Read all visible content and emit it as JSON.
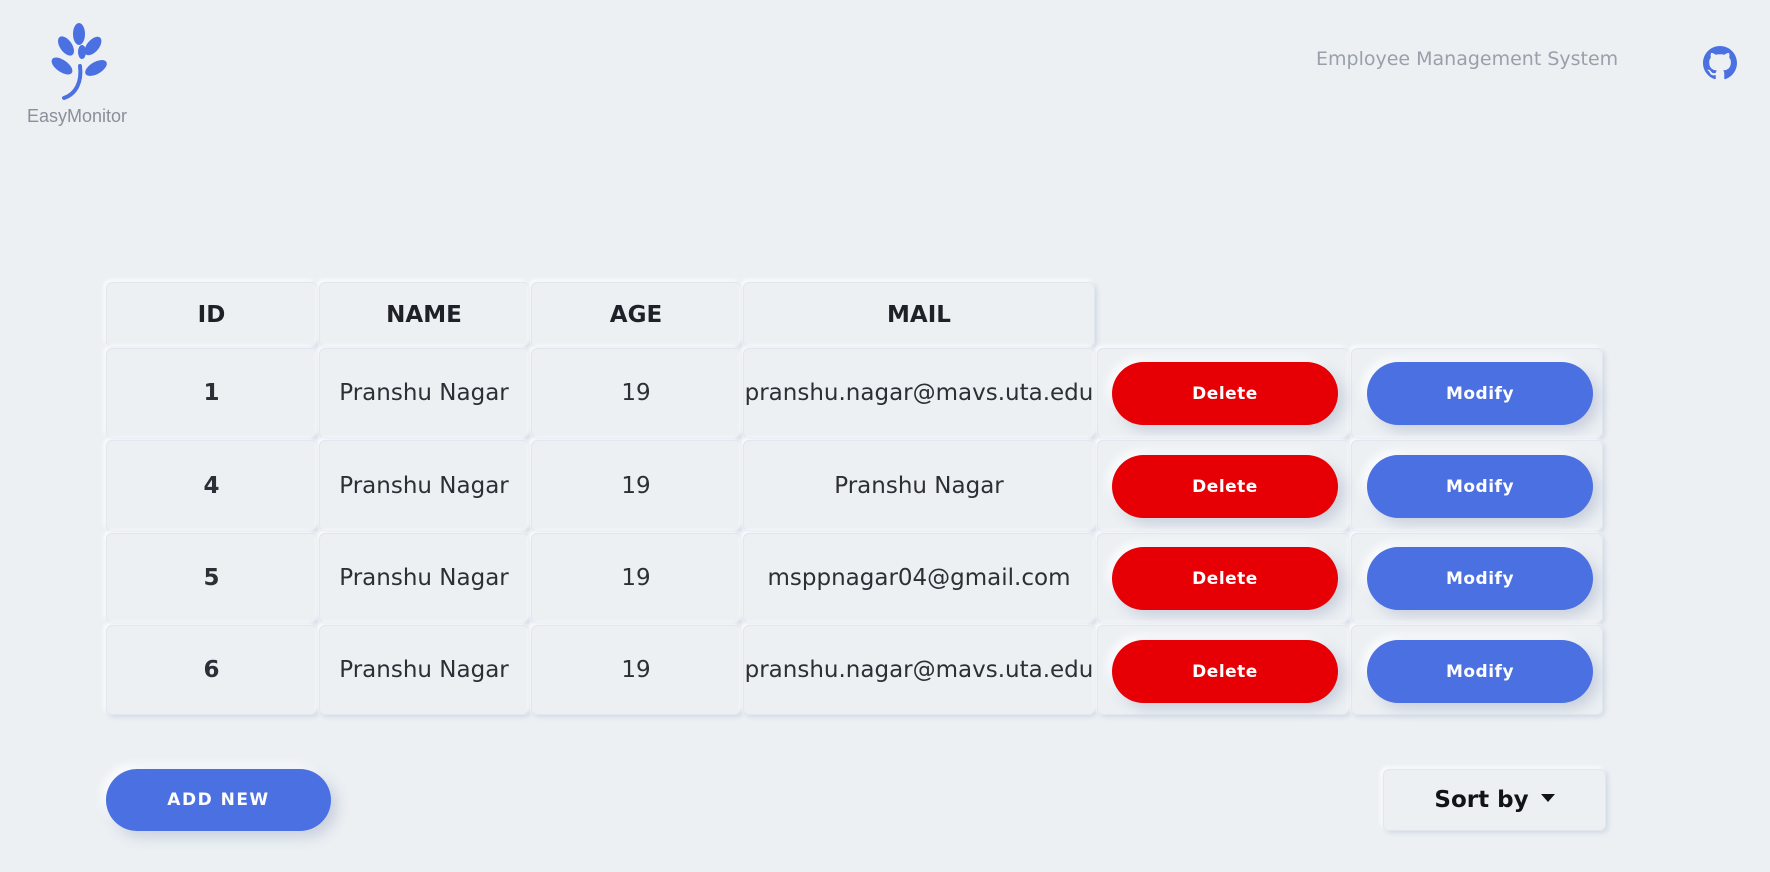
{
  "brand": {
    "name": "EasyMonitor",
    "logo_icon": "leaf-icon",
    "accent_color": "#4b70e2"
  },
  "header": {
    "title": "Employee Management System",
    "github_icon": "github-icon"
  },
  "table": {
    "headers": [
      "ID",
      "NAME",
      "AGE",
      "MAIL"
    ],
    "rows": [
      {
        "id": "1",
        "name": "Pranshu Nagar",
        "age": "19",
        "mail": "pranshu.nagar@mavs.uta.edu"
      },
      {
        "id": "4",
        "name": "Pranshu Nagar",
        "age": "19",
        "mail": "Pranshu Nagar"
      },
      {
        "id": "5",
        "name": "Pranshu Nagar",
        "age": "19",
        "mail": "msppnagar04@gmail.com"
      },
      {
        "id": "6",
        "name": "Pranshu Nagar",
        "age": "19",
        "mail": "pranshu.nagar@mavs.uta.edu"
      }
    ],
    "delete_label": "Delete",
    "modify_label": "Modify",
    "delete_color": "#e60005",
    "modify_color": "#4b70e2"
  },
  "actions": {
    "add_new_label": "ADD NEW",
    "sort_label": "Sort by"
  }
}
